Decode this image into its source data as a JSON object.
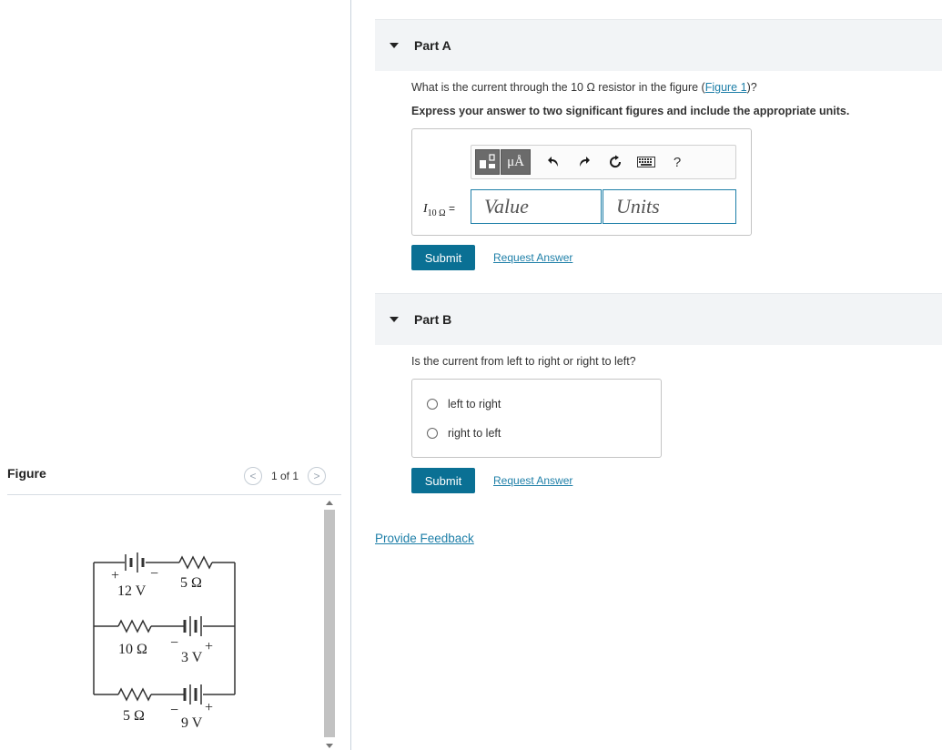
{
  "figure_panel": {
    "title": "Figure",
    "pager": {
      "prev": "<",
      "label": "1 of 1",
      "next": ">"
    },
    "circuit": {
      "labels": {
        "battery_top": "12 V",
        "resistor_top": "5 Ω",
        "resistor_mid": "10 Ω",
        "battery_mid": "3 V",
        "resistor_bottom": "5 Ω",
        "battery_bottom": "9 V",
        "plus": "+",
        "minus": "−"
      }
    }
  },
  "part_a": {
    "header": "Part A",
    "question_prefix": "What is the current through the 10 Ω resistor in the figure (",
    "question_link": "Figure 1",
    "question_suffix": ")?",
    "instruction": "Express your answer to two significant figures and include the appropriate units.",
    "toolbar": {
      "units_btn": "μÅ",
      "help": "?"
    },
    "var_label": {
      "main": "I",
      "sub": "10 Ω",
      "eq": " ="
    },
    "value_placeholder": "Value",
    "units_placeholder": "Units",
    "submit": "Submit",
    "request": "Request Answer"
  },
  "part_b": {
    "header": "Part B",
    "question": "Is the current from left to right or right to left?",
    "options": [
      "left to right",
      "right to left"
    ],
    "submit": "Submit",
    "request": "Request Answer"
  },
  "feedback": "Provide Feedback"
}
